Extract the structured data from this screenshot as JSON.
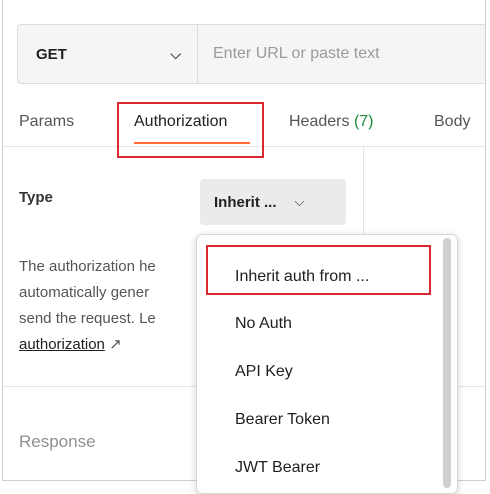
{
  "request": {
    "method": "GET",
    "url_placeholder": "Enter URL or paste text",
    "url_value": ""
  },
  "tabs": [
    {
      "label": "Params"
    },
    {
      "label": "Authorization"
    },
    {
      "label": "Headers",
      "count": "(7)"
    },
    {
      "label": "Body"
    }
  ],
  "auth": {
    "type_label": "Type",
    "type_selected": "Inherit ...",
    "description_lines": [
      "The authorization he",
      "automatically gener",
      "send the request. Le"
    ],
    "link_text": "authorization",
    "link_arrow": "↗"
  },
  "menu": {
    "items": [
      {
        "label": "Inherit auth from ..."
      },
      {
        "label": "No Auth"
      },
      {
        "label": "API Key"
      },
      {
        "label": "Bearer Token"
      },
      {
        "label": "JWT Bearer"
      }
    ]
  },
  "response": {
    "label": "Response"
  },
  "colors": {
    "accent": "#ff6c37",
    "highlight": "#d9282f",
    "count": "#1e8a3a"
  }
}
